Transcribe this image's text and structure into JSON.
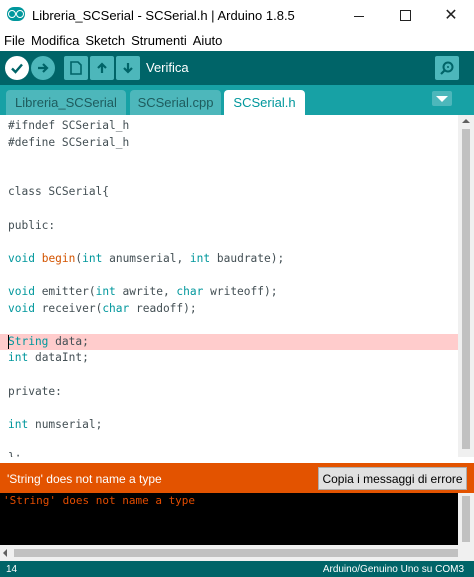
{
  "window": {
    "title": "Libreria_SCSerial - SCSerial.h | Arduino 1.8.5",
    "min_glyph": "",
    "close_glyph": "✕"
  },
  "menu": [
    "File",
    "Modifica",
    "Sketch",
    "Strumenti",
    "Aiuto"
  ],
  "toolbar": {
    "status_label": "Verifica",
    "icons": [
      "check-icon",
      "arrow-right-icon",
      "new-file-icon",
      "open-arrow-up-icon",
      "save-arrow-down-icon",
      "serial-monitor-icon"
    ]
  },
  "tabs": [
    {
      "label": "Libreria_SCSerial",
      "active": false
    },
    {
      "label": "SCSerial.cpp",
      "active": false
    },
    {
      "label": "SCSerial.h",
      "active": true
    }
  ],
  "code": {
    "lines": [
      [
        {
          "t": "#ifndef SCSerial_h"
        }
      ],
      [
        {
          "t": "#define SCSerial_h"
        }
      ],
      [],
      [],
      [
        {
          "t": "class SCSerial{"
        }
      ],
      [],
      [
        {
          "t": "public:"
        }
      ],
      [],
      [
        {
          "t": "void",
          "c": "kw"
        },
        {
          "t": " "
        },
        {
          "t": "begin",
          "c": "fn"
        },
        {
          "t": "("
        },
        {
          "t": "int",
          "c": "kw"
        },
        {
          "t": " anumserial, "
        },
        {
          "t": "int",
          "c": "kw"
        },
        {
          "t": " baudrate);"
        }
      ],
      [],
      [
        {
          "t": "void",
          "c": "kw"
        },
        {
          "t": " emitter("
        },
        {
          "t": "int",
          "c": "kw"
        },
        {
          "t": " awrite, "
        },
        {
          "t": "char",
          "c": "kw"
        },
        {
          "t": " writeoff);"
        }
      ],
      [
        {
          "t": "void",
          "c": "kw"
        },
        {
          "t": " receiver("
        },
        {
          "t": "char",
          "c": "kw"
        },
        {
          "t": " readoff);"
        }
      ],
      [],
      [
        {
          "t": "String",
          "c": "kw"
        },
        {
          "t": " data;"
        }
      ],
      [
        {
          "t": "int",
          "c": "kw"
        },
        {
          "t": " dataInt;"
        }
      ],
      [],
      [
        {
          "t": "private:"
        }
      ],
      [],
      [
        {
          "t": "int",
          "c": "kw"
        },
        {
          "t": " numserial;"
        }
      ],
      [],
      [
        {
          "t": "};"
        }
      ]
    ],
    "highlighted_line_index": 13,
    "colors": {
      "keyword": "#00979c",
      "function": "#d35400",
      "text": "#434f54",
      "highlight": "#ffcccc"
    }
  },
  "status": {
    "message": "'String' does not name a type",
    "copy_button": "Copia i messaggi di errore",
    "color": "#e35300"
  },
  "console": {
    "output": "'String' does not name a type"
  },
  "footer": {
    "line_number": "14",
    "board": "Arduino/Genuino Uno su COM3"
  }
}
